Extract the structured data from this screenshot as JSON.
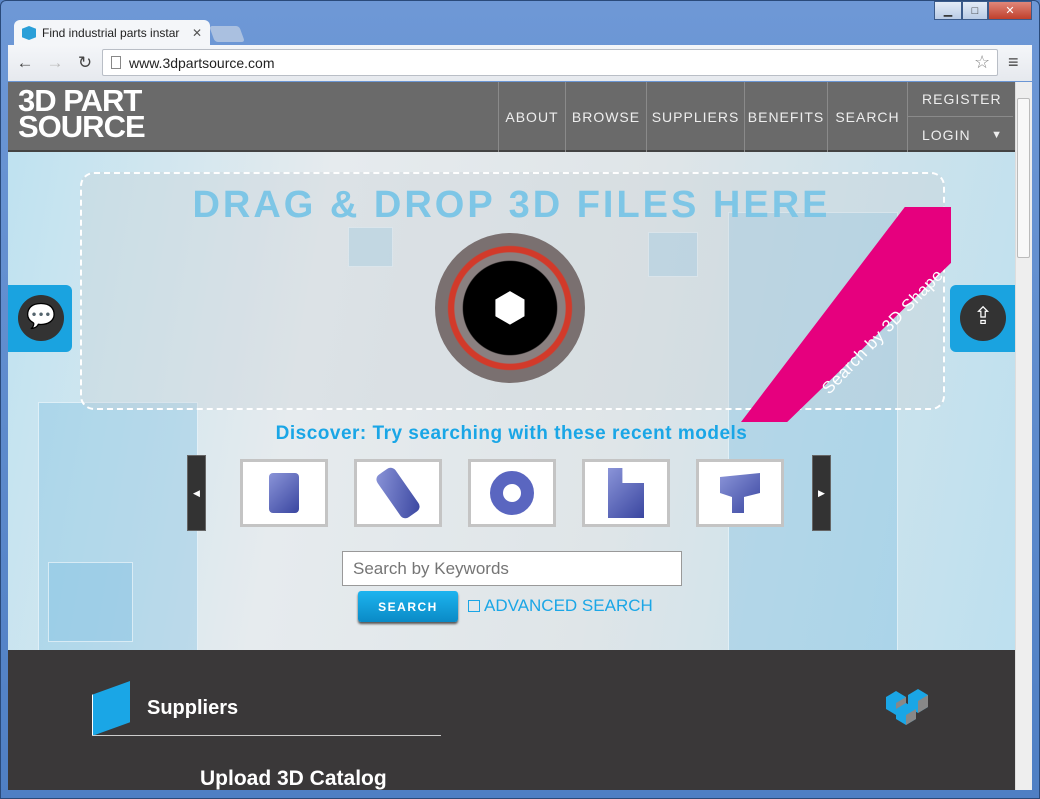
{
  "browser": {
    "tab_title": "Find industrial parts instar",
    "url": "www.3dpartsource.com",
    "window_controls": [
      "minimize",
      "maximize",
      "close"
    ]
  },
  "header": {
    "logo_line1": "3D PART",
    "logo_line2": "SOURCE",
    "nav": [
      "ABOUT",
      "BROWSE",
      "SUPPLIERS",
      "BENEFITS",
      "SEARCH"
    ],
    "register": "REGISTER",
    "login": "LOGIN",
    "login_caret": "▼"
  },
  "hero": {
    "drop_title": "DRAG & DROP 3D FILES HERE",
    "ribbon": "Search by 3D Shape",
    "discover": "Discover: Try searching with these recent models",
    "models": [
      "sensor",
      "worm-gear",
      "washer",
      "bracket",
      "elbow-fitting"
    ],
    "search_placeholder": "Search by Keywords",
    "search_button": "SEARCH",
    "advanced_search": "ADVANCED SEARCH"
  },
  "suppliers": {
    "title": "Suppliers",
    "upload": "Upload 3D Catalog"
  },
  "colors": {
    "accent": "#1aa6e6",
    "ribbon": "#e6007e",
    "dark": "#3a3839"
  }
}
